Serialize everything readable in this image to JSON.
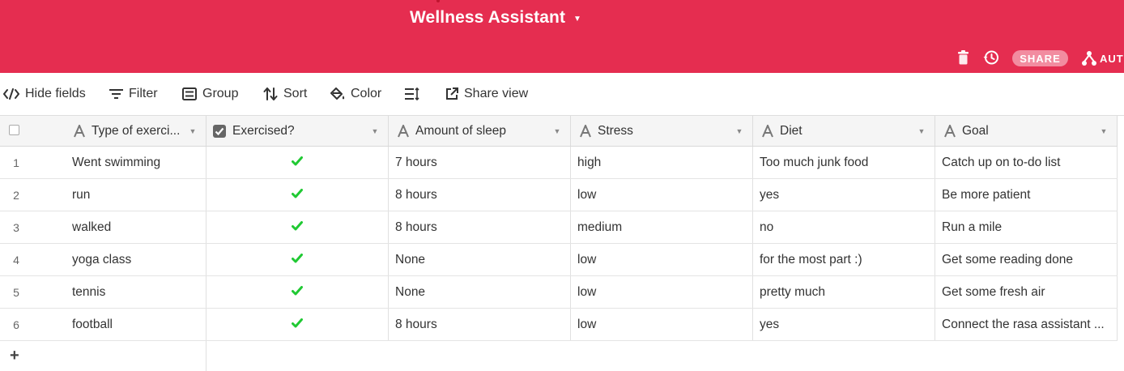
{
  "base": {
    "title": "Wellness Assistant"
  },
  "top_actions": {
    "share_label": "SHARE",
    "automation_label": "AUTO"
  },
  "toolbar": {
    "hide_fields": "Hide fields",
    "filter": "Filter",
    "group": "Group",
    "sort": "Sort",
    "color": "Color",
    "share_view": "Share view"
  },
  "columns": [
    {
      "name": "Type of exerci...",
      "type_icon": "text-field-icon"
    },
    {
      "name": "Exercised?",
      "type_icon": "checkbox-field-icon"
    },
    {
      "name": "Amount of sleep",
      "type_icon": "text-field-icon"
    },
    {
      "name": "Stress",
      "type_icon": "text-field-icon"
    },
    {
      "name": "Diet",
      "type_icon": "text-field-icon"
    },
    {
      "name": "Goal",
      "type_icon": "text-field-icon"
    }
  ],
  "rows": [
    {
      "num": "1",
      "exercise": "Went swimming",
      "exercised": true,
      "sleep": "7 hours",
      "stress": "high",
      "diet": "Too much junk food",
      "goal": "Catch up on to-do list"
    },
    {
      "num": "2",
      "exercise": "run",
      "exercised": true,
      "sleep": "8 hours",
      "stress": "low",
      "diet": "yes",
      "goal": "Be more patient"
    },
    {
      "num": "3",
      "exercise": "walked",
      "exercised": true,
      "sleep": "8 hours",
      "stress": "medium",
      "diet": "no",
      "goal": "Run a mile"
    },
    {
      "num": "4",
      "exercise": "yoga class",
      "exercised": true,
      "sleep": "None",
      "stress": "low",
      "diet": "for the most part :)",
      "goal": "Get some reading done"
    },
    {
      "num": "5",
      "exercise": "tennis",
      "exercised": true,
      "sleep": "None",
      "stress": "low",
      "diet": "pretty much",
      "goal": "Get some fresh air"
    },
    {
      "num": "6",
      "exercise": "football",
      "exercised": true,
      "sleep": "8 hours",
      "stress": "low",
      "diet": "yes",
      "goal": "Connect the rasa assistant ..."
    }
  ],
  "add_row_label": "+",
  "colors": {
    "header_bg": "#e52d50",
    "check_green": "#20c933"
  }
}
